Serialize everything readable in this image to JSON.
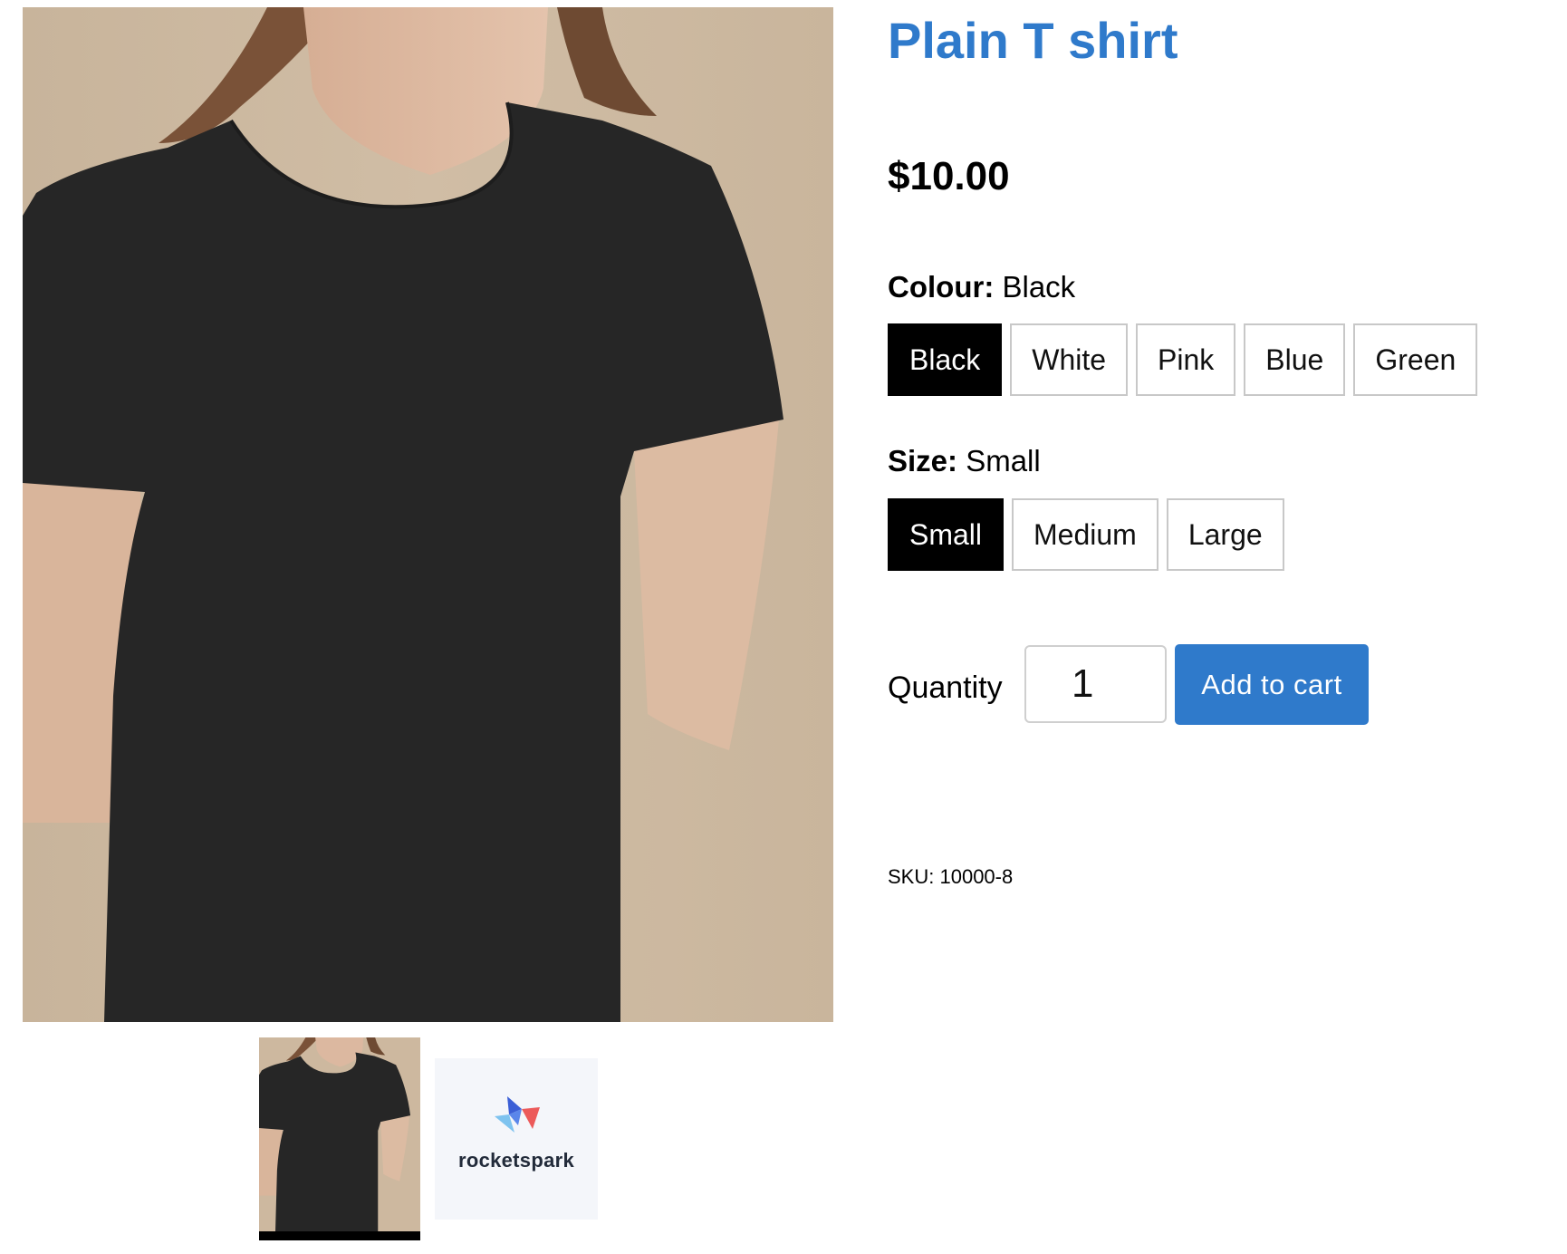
{
  "product": {
    "title": "Plain T shirt",
    "price": "$10.00",
    "sku_label": "SKU:",
    "sku_value": "10000-8"
  },
  "options": {
    "colour": {
      "label": "Colour:",
      "selected": "Black",
      "values": [
        "Black",
        "White",
        "Pink",
        "Blue",
        "Green"
      ]
    },
    "size": {
      "label": "Size:",
      "selected": "Small",
      "values": [
        "Small",
        "Medium",
        "Large"
      ]
    }
  },
  "purchase": {
    "quantity_label": "Quantity",
    "quantity_value": "1",
    "add_to_cart_label": "Add to cart"
  },
  "gallery": {
    "thumbnails": [
      "black-tshirt-photo",
      "rocketspark-logo"
    ],
    "active_index": 0,
    "logo_text": "rocketspark"
  },
  "colors": {
    "accent": "#2f7acb",
    "selected_swatch": "#000000",
    "image_background": "#ccb8a0",
    "shirt": "#262626",
    "skin": "#dcb8a0"
  }
}
